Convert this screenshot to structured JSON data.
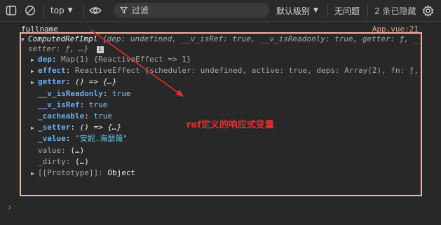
{
  "toolbar": {
    "context": "top",
    "filter_placeholder": "过滤",
    "level": "默认级别",
    "issues": "无问题",
    "hidden": "2 条已隐藏"
  },
  "console": {
    "label": "fullname",
    "source": "App.vue:21",
    "summary_name": "ComputedRefImpl",
    "summary_rest": " {dep: undefined, __v_isRef: true, __v_isReadonly: true, getter: ƒ, _",
    "summary_line2": "setter: ƒ, …}",
    "info_badge": "i",
    "rows": [
      {
        "key": "dep",
        "value": "Map(1) {ReactiveEffect => 1}",
        "expandable": true
      },
      {
        "key": "effect",
        "value": "ReactiveEffect {scheduler: undefined, active: true, deps: Array(2), fn: ƒ,",
        "expandable": true
      },
      {
        "key": "getter",
        "value": "() => {…}",
        "expandable": true
      },
      {
        "key": "__v_isReadonly",
        "value": "true",
        "expandable": false
      },
      {
        "key": "__v_isRef",
        "value": "true",
        "expandable": false
      },
      {
        "key": "_cacheable",
        "value": "true",
        "expandable": false
      },
      {
        "key": "_setter",
        "value": "() => {…}",
        "expandable": true
      },
      {
        "key": "_value",
        "value": "\"安妮.海瑟薇\"",
        "expandable": false
      },
      {
        "key": "value",
        "value": "(…)",
        "expandable": false
      },
      {
        "key": "_dirty",
        "value": "(…)",
        "expandable": false
      },
      {
        "key": "[[Prototype]]",
        "value": "Object",
        "expandable": true
      }
    ],
    "annotation": "ref定义的响应式变量",
    "prompt": "›"
  }
}
